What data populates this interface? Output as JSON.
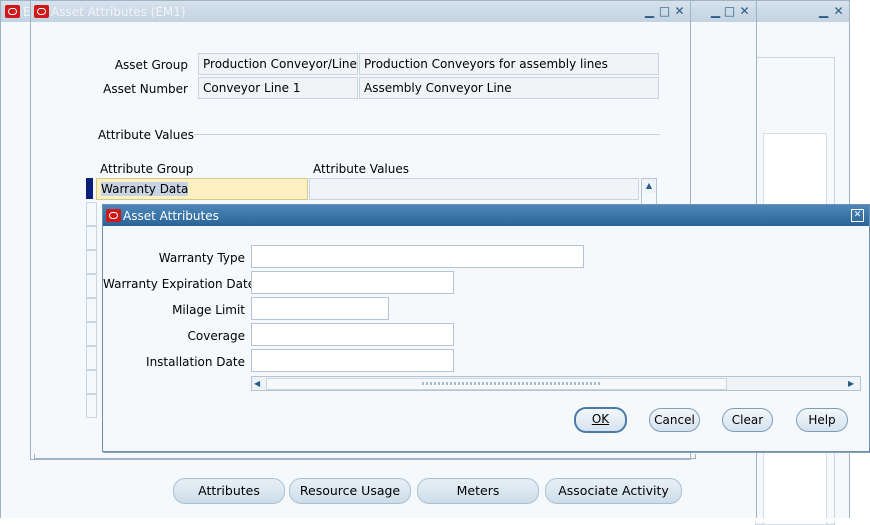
{
  "bg_window_1": {
    "title": "E"
  },
  "main_window": {
    "title": "Asset Attributes (EM1)",
    "asset_group_label": "Asset Group",
    "asset_group_value": "Production Conveyor/Line",
    "asset_group_desc": "Production Conveyors for assembly lines",
    "asset_number_label": "Asset Number",
    "asset_number_value": "Conveyor Line 1",
    "asset_number_desc": "Assembly Conveyor Line",
    "section_title": "Attribute Values",
    "col_attribute_group": "Attribute Group",
    "col_attribute_values": "Attribute Values",
    "first_row_group": "Warranty Data",
    "first_row_value": ""
  },
  "dialog": {
    "title": "Asset Attributes",
    "fields": [
      {
        "label": "Warranty Type",
        "value": ""
      },
      {
        "label": "Warranty Expiration Date",
        "value": ""
      },
      {
        "label": "Milage Limit",
        "value": ""
      },
      {
        "label": "Coverage",
        "value": ""
      },
      {
        "label": "Installation Date",
        "value": ""
      }
    ],
    "buttons": {
      "ok": "OK",
      "cancel": "Cancel",
      "clear": "Clear",
      "help": "Help"
    }
  },
  "bottom_buttons": {
    "attributes": "Attributes",
    "resource_usage": "Resource Usage",
    "meters": "Meters",
    "associate_activity": "Associate Activity"
  },
  "icons": {
    "oracle_logo": "oracle-logo-icon",
    "minimize": "minimize-icon",
    "maximize": "maximize-icon",
    "close": "close-icon"
  },
  "colors": {
    "active_titlebar": "#2a6496",
    "inactive_titlebar": "#c3d3e1",
    "selected_cell": "#fdf0c0",
    "oracle_red": "#d01818"
  }
}
